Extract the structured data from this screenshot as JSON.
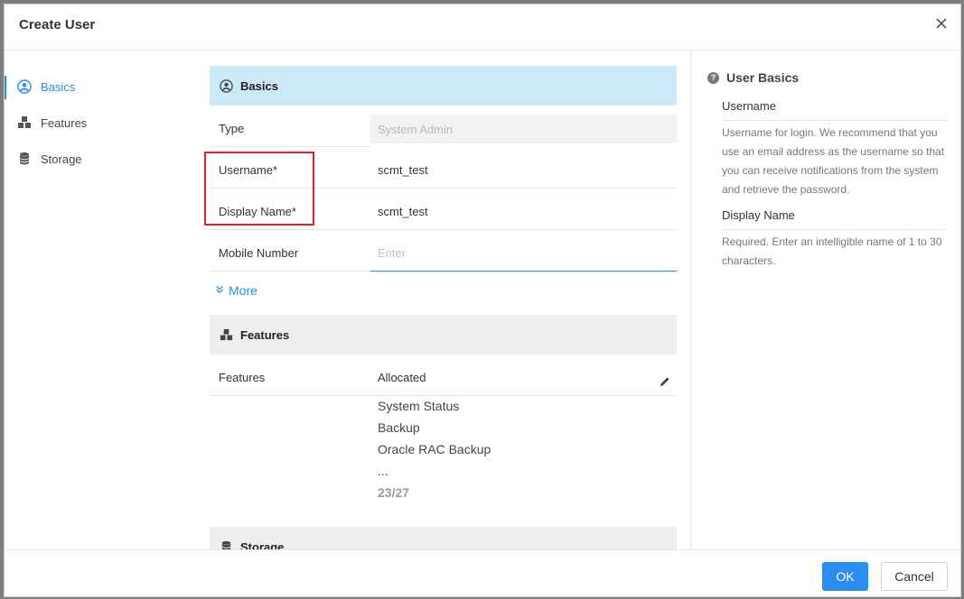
{
  "dialog": {
    "title": "Create User"
  },
  "nav": [
    {
      "label": "Basics",
      "icon": "user-circle-icon"
    },
    {
      "label": "Features",
      "icon": "cubes-icon"
    },
    {
      "label": "Storage",
      "icon": "database-icon"
    }
  ],
  "basics": {
    "heading": "Basics",
    "type_label": "Type",
    "type_value": "System Admin",
    "username_label": "Username*",
    "username_value": "scmt_test",
    "display_name_label": "Display Name*",
    "display_name_value": "scmt_test",
    "mobile_label": "Mobile Number",
    "mobile_placeholder": "Enter",
    "more_label": "More"
  },
  "features": {
    "heading": "Features",
    "label": "Features",
    "value": "Allocated",
    "items": [
      "System Status",
      "Backup",
      "Oracle RAC Backup",
      "..."
    ],
    "count": "23/27"
  },
  "storage": {
    "heading": "Storage"
  },
  "help": {
    "title": "User Basics",
    "username_heading": "Username",
    "username_text": "Username for login. We recommend that you use an email address as the username so that you can receive notifications from the system and retrieve the password.",
    "display_name_heading": "Display Name",
    "display_name_text": "Required. Enter an intelligible name of 1 to 30 characters."
  },
  "footer": {
    "ok_label": "OK",
    "cancel_label": "Cancel"
  },
  "colors": {
    "accent": "#2a8ef0",
    "basics_header_bg": "#cce9f7",
    "highlight_border": "#d9262c"
  }
}
